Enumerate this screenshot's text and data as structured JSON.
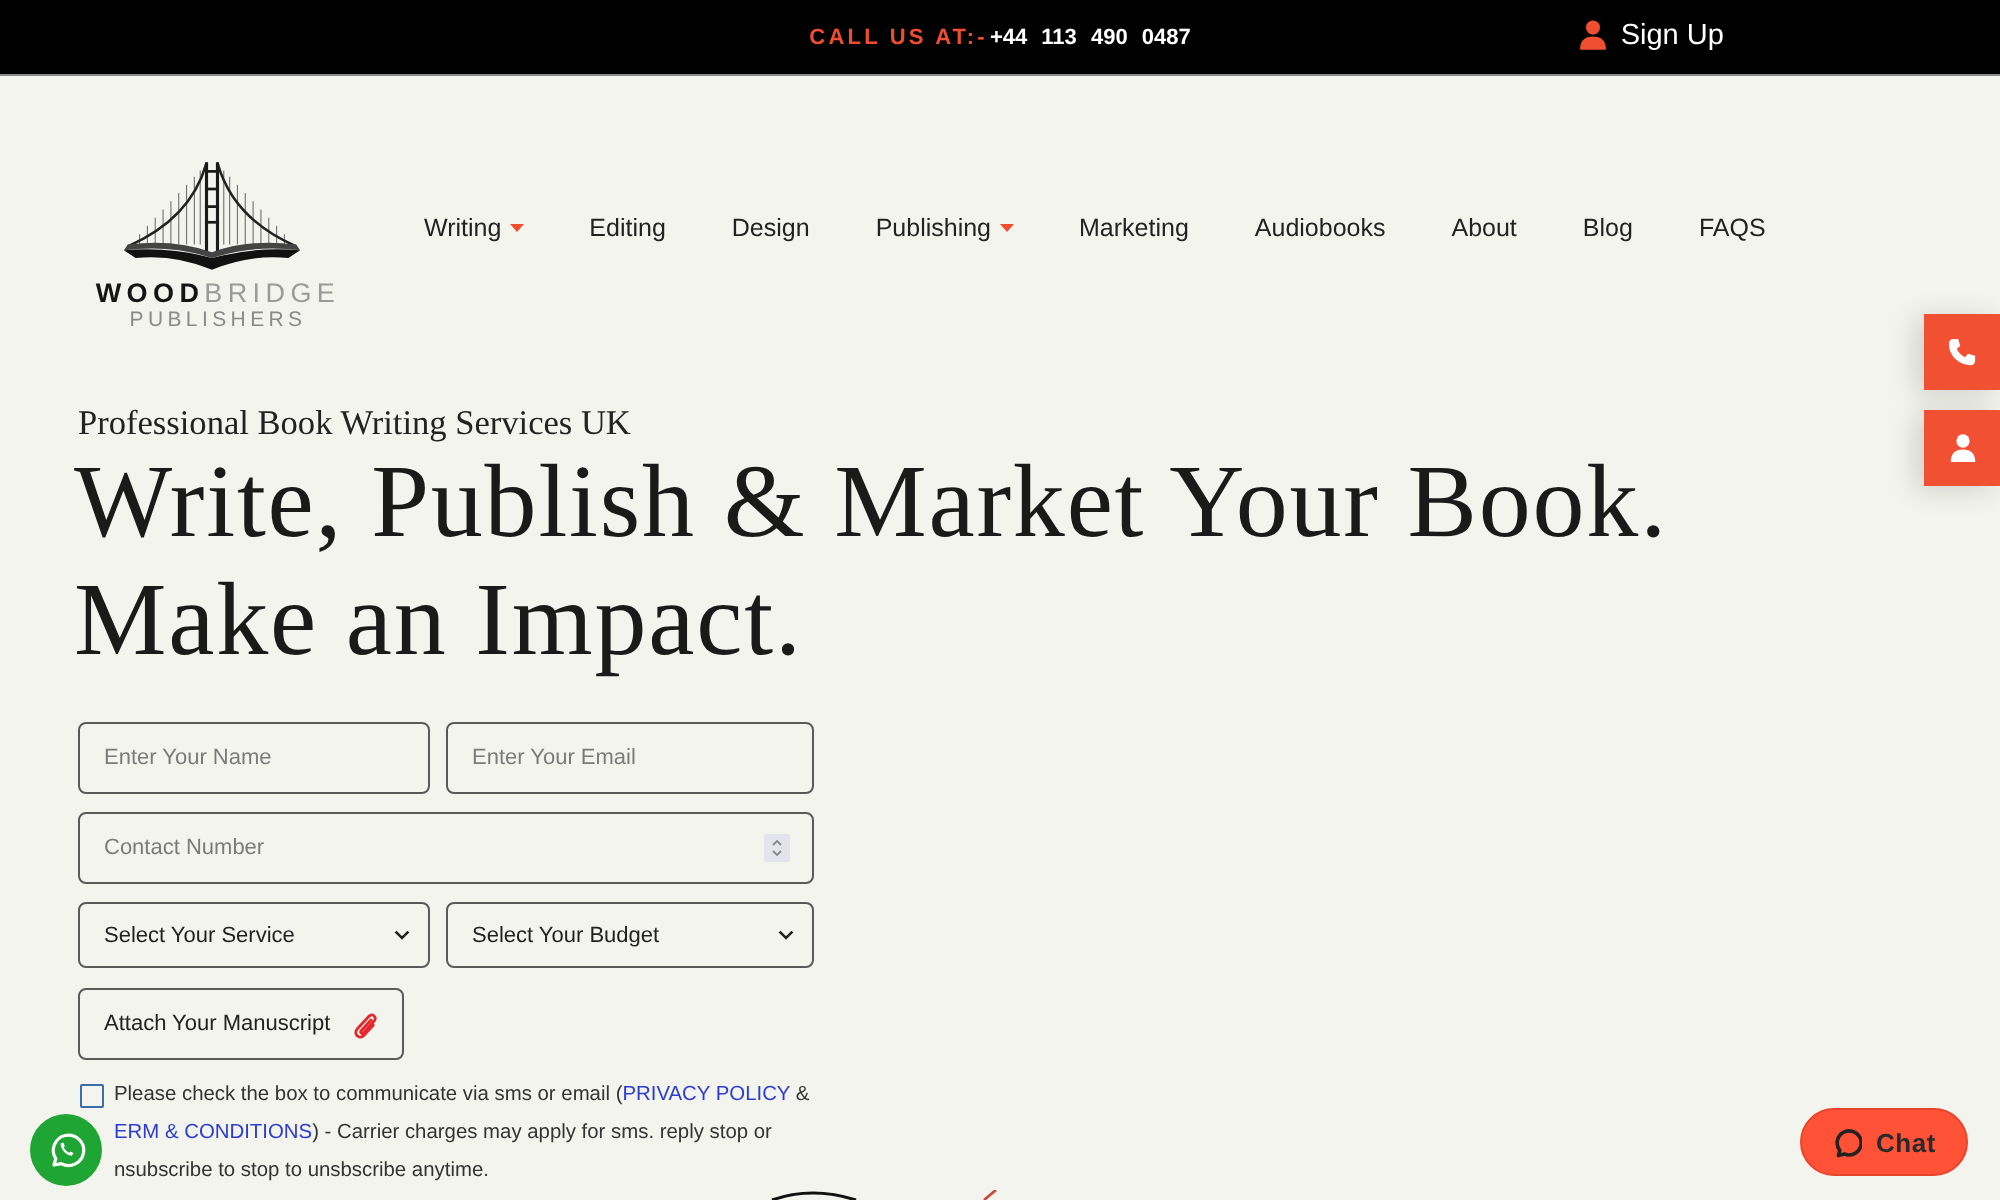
{
  "top_bar": {
    "call_label": "CALL US AT:-",
    "phone": "+44 113 490 0487",
    "sign_up": "Sign Up"
  },
  "logo": {
    "name": "**WOOD**BRIDGE",
    "tagline": "PUBLISHERS"
  },
  "nav": [
    {
      "label": "Writing",
      "has_menu": true
    },
    {
      "label": "Editing",
      "has_menu": false
    },
    {
      "label": "Design",
      "has_menu": false
    },
    {
      "label": "Publishing",
      "has_menu": true
    },
    {
      "label": "Marketing",
      "has_menu": false
    },
    {
      "label": "Audiobooks",
      "has_menu": false
    },
    {
      "label": "About",
      "has_menu": false
    },
    {
      "label": "Blog",
      "has_menu": false
    },
    {
      "label": "FAQS",
      "has_menu": false
    }
  ],
  "hero": {
    "eyebrow": "Professional Book Writing Services UK",
    "headline_lines": [
      "Write, Publish & Market Your Book.",
      "Make an Impact."
    ]
  },
  "form": {
    "fields": [
      {
        "kind": "text",
        "placeholder": "Enter Your Name"
      },
      {
        "kind": "text",
        "placeholder": "Enter Your Email"
      },
      {
        "kind": "number",
        "placeholder": "Contact Number"
      },
      {
        "kind": "select",
        "value": "Select Your Service"
      },
      {
        "kind": "select",
        "value": "Select Your Budget"
      }
    ],
    "attach_button": "Attach Your Manuscript"
  },
  "consent": {
    "checked": false,
    "parts": [
      {
        "kind": "text",
        "text": "Please check the box to communicate via sms or email ("
      },
      {
        "kind": "link",
        "text": "PRIVACY POLICY"
      },
      {
        "kind": "text",
        "text": " & "
      },
      {
        "kind": "link",
        "text": "ERM & CONDITIONS"
      },
      {
        "kind": "text",
        "text": ") - Carrier charges may apply for sms. reply stop or nsubscribe to stop to unsbscribe anytime."
      }
    ]
  },
  "chat_button": {
    "label": "Chat"
  }
}
